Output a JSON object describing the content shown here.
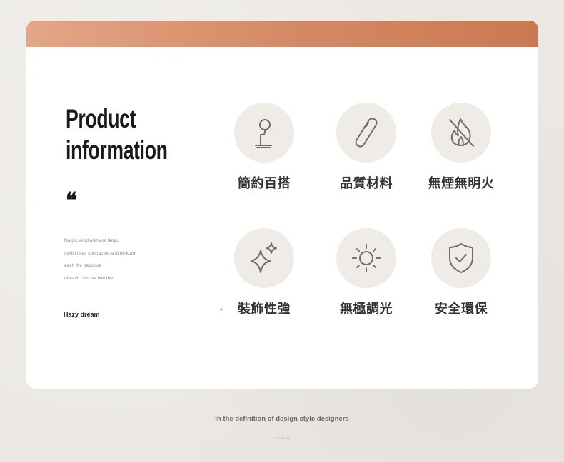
{
  "header": {
    "accent_color": "#d58a66"
  },
  "intro": {
    "title_line1": "Product",
    "title_line2": "information",
    "quote_mark": "❝",
    "desc_lines": [
      "Nordic wind element lamp,",
      "stylist cites contracted and dinkum",
      "each the backside",
      "of each concise line the"
    ],
    "tagline": "Hazy dream",
    "small_mark": "A"
  },
  "features": [
    {
      "icon": "desk-lamp-icon",
      "label": "簡約百搭"
    },
    {
      "icon": "capsule-icon",
      "label": "品質材料"
    },
    {
      "icon": "no-fire-icon",
      "label": "無煙無明火"
    },
    {
      "icon": "sparkle-icon",
      "label": "裝飾性強"
    },
    {
      "icon": "sun-icon",
      "label": "無極調光"
    },
    {
      "icon": "shield-check-icon",
      "label": "安全環保"
    }
  ],
  "footer": {
    "caption": "In the definition of design style designers",
    "dots": "wwwww"
  }
}
